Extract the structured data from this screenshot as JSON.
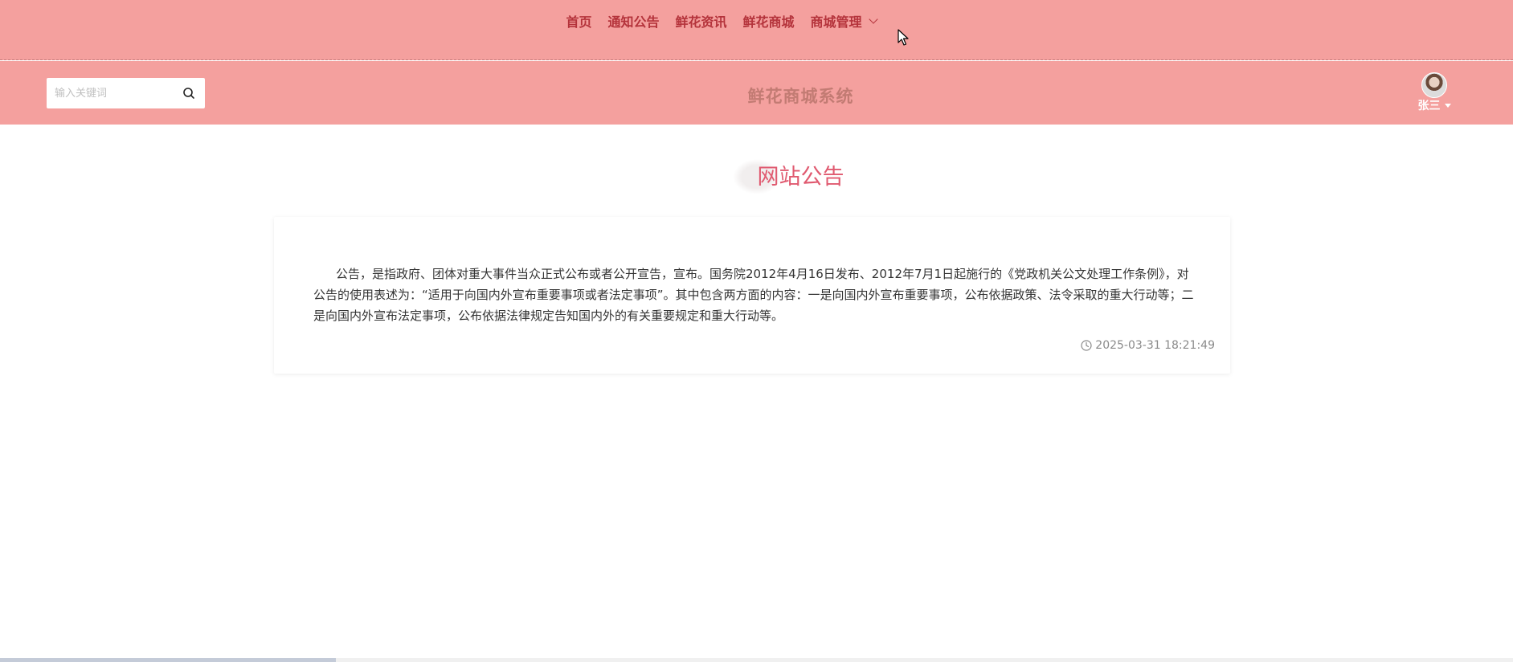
{
  "nav": {
    "items": [
      {
        "label": "首页"
      },
      {
        "label": "通知公告"
      },
      {
        "label": "鲜花资讯"
      },
      {
        "label": "鲜花商城"
      },
      {
        "label": "商城管理"
      }
    ]
  },
  "header": {
    "search_placeholder": "输入关键词",
    "site_title": "鲜花商城系统",
    "username": "张三"
  },
  "main": {
    "section_title": "网站公告",
    "notice": {
      "content": "公告，是指政府、团体对重大事件当众正式公布或者公开宣告，宣布。国务院2012年4月16日发布、2012年7月1日起施行的《党政机关公文处理工作条例》，对公告的使用表述为：“适用于向国内外宣布重要事项或者法定事项”。其中包含两方面的内容：一是向国内外宣布重要事项，公布依据政策、法令采取的重大行动等；二是向国内外宣布法定事项，公布依据法律规定告知国内外的有关重要规定和重大行动等。",
      "time": "2025-03-31 18:21:49"
    }
  },
  "colors": {
    "header_bg": "#f4a09e",
    "nav_text": "#b4333b",
    "section_title": "#e05a70"
  },
  "icons": {
    "search": "search-icon",
    "clock": "clock-icon",
    "dropdown": "chevron-down-icon"
  }
}
